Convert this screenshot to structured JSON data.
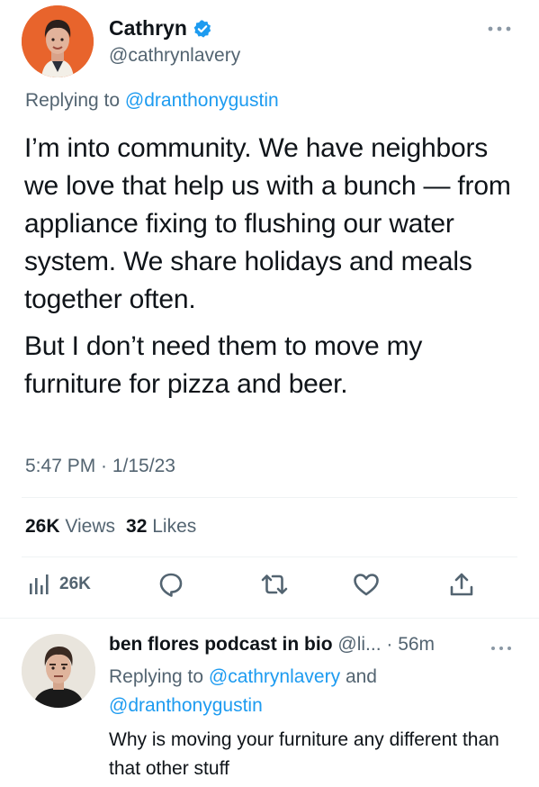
{
  "main_tweet": {
    "author": {
      "display_name": "Cathryn",
      "handle": "@cathrynlavery",
      "verified": true,
      "avatar_icon": "user-avatar-icon"
    },
    "replying_prefix": "Replying to",
    "replying_to": "@dranthonygustin",
    "paragraphs": [
      "I’m into community. We have neighbors  we love that help us with a bunch — from appliance fixing to flushing our water system. We share holidays and meals together often.",
      "But I don’t need them to move my furniture for pizza and beer."
    ],
    "timestamp": "5:47 PM · 1/15/23",
    "stats": {
      "views_count": "26K",
      "views_label": "Views",
      "likes_count": "32",
      "likes_label": "Likes"
    },
    "actions": {
      "analytics_count": "26K",
      "icons": [
        "analytics-icon",
        "reply-icon",
        "retweet-icon",
        "like-icon",
        "share-icon"
      ]
    }
  },
  "reply_tweet": {
    "author": {
      "display_name": "ben flores podcast in bio",
      "handle_truncated": "@li...",
      "time": "56m",
      "meta": "@li... · 56m"
    },
    "replying_prefix": "Replying to",
    "replying_to_1": "@cathrynlavery",
    "replying_and": "and",
    "replying_to_2": "@dranthonygustin",
    "text": "Why is moving your furniture any different than that other stuff"
  },
  "colors": {
    "accent": "#1d9bf0",
    "text_primary": "#0f1419",
    "text_secondary": "#536471",
    "divider": "#eff3f4",
    "avatar_bg": "#e8642c"
  }
}
